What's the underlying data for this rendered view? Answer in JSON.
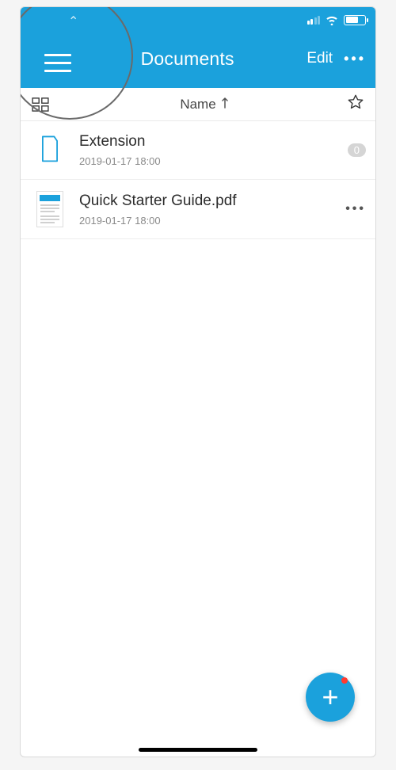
{
  "header": {
    "title": "Documents",
    "edit_label": "Edit"
  },
  "sortbar": {
    "sort_label": "Name"
  },
  "items": [
    {
      "name": "Extension",
      "date": "2019-01-17 18:00",
      "badge": "0",
      "type": "folder"
    },
    {
      "name": "Quick Starter Guide.pdf",
      "date": "2019-01-17 18:00",
      "type": "pdf"
    }
  ]
}
